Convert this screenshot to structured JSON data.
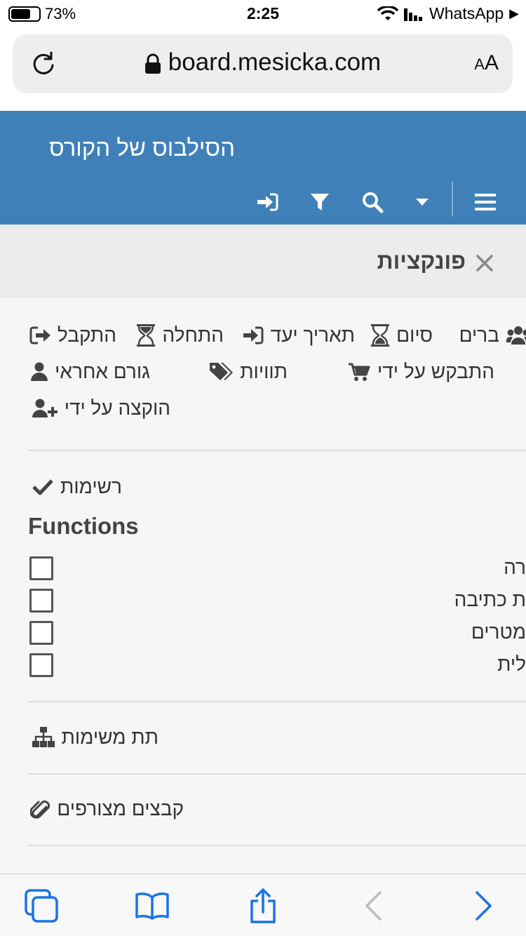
{
  "status_bar": {
    "battery": "73%",
    "battery_level": 0.73,
    "time": "2:25",
    "back_app": "WhatsApp"
  },
  "browser": {
    "url": "board.mesicka.com",
    "text_size_label": "AA"
  },
  "app": {
    "title": "הסילבוס של הקורס",
    "header_color": "#4080b8",
    "toolbar_icons": [
      "menu-icon",
      "caret-down-icon",
      "search-icon",
      "filter-icon",
      "sign-in-icon"
    ]
  },
  "panel": {
    "title": "פונקציות"
  },
  "functions": [
    {
      "label": "ברים",
      "icon": "users-icon"
    },
    {
      "label": "סיום",
      "icon": "hourglass-end-icon"
    },
    {
      "label": "תאריך יעד",
      "icon": "sign-in-icon"
    },
    {
      "label": "התחלה",
      "icon": "hourglass-start-icon"
    },
    {
      "label": "התקבל",
      "icon": "sign-out-icon"
    },
    {
      "label": "התבקש על ידי",
      "icon": "cart-icon"
    },
    {
      "label": "תוויות",
      "icon": "tags-icon"
    },
    {
      "label": "גורם אחראי",
      "icon": "user-icon"
    },
    {
      "label": "הוקצה על ידי",
      "icon": "user-plus-icon"
    }
  ],
  "checklists": {
    "label": "רשימות",
    "title": "Functions",
    "items": [
      {
        "label": "רה",
        "checked": false
      },
      {
        "label": "ת כתיבה",
        "checked": false
      },
      {
        "label": "מטרים",
        "checked": false
      },
      {
        "label": "לית",
        "checked": false
      }
    ]
  },
  "subtasks": {
    "label": "תת משימות"
  },
  "attachments": {
    "label": "קבצים מצורפים"
  },
  "bottom_bar": {
    "icons": [
      "tabs-icon",
      "bookmarks-icon",
      "share-icon",
      "back-icon",
      "forward-icon"
    ],
    "accent": "#1a73e8"
  }
}
